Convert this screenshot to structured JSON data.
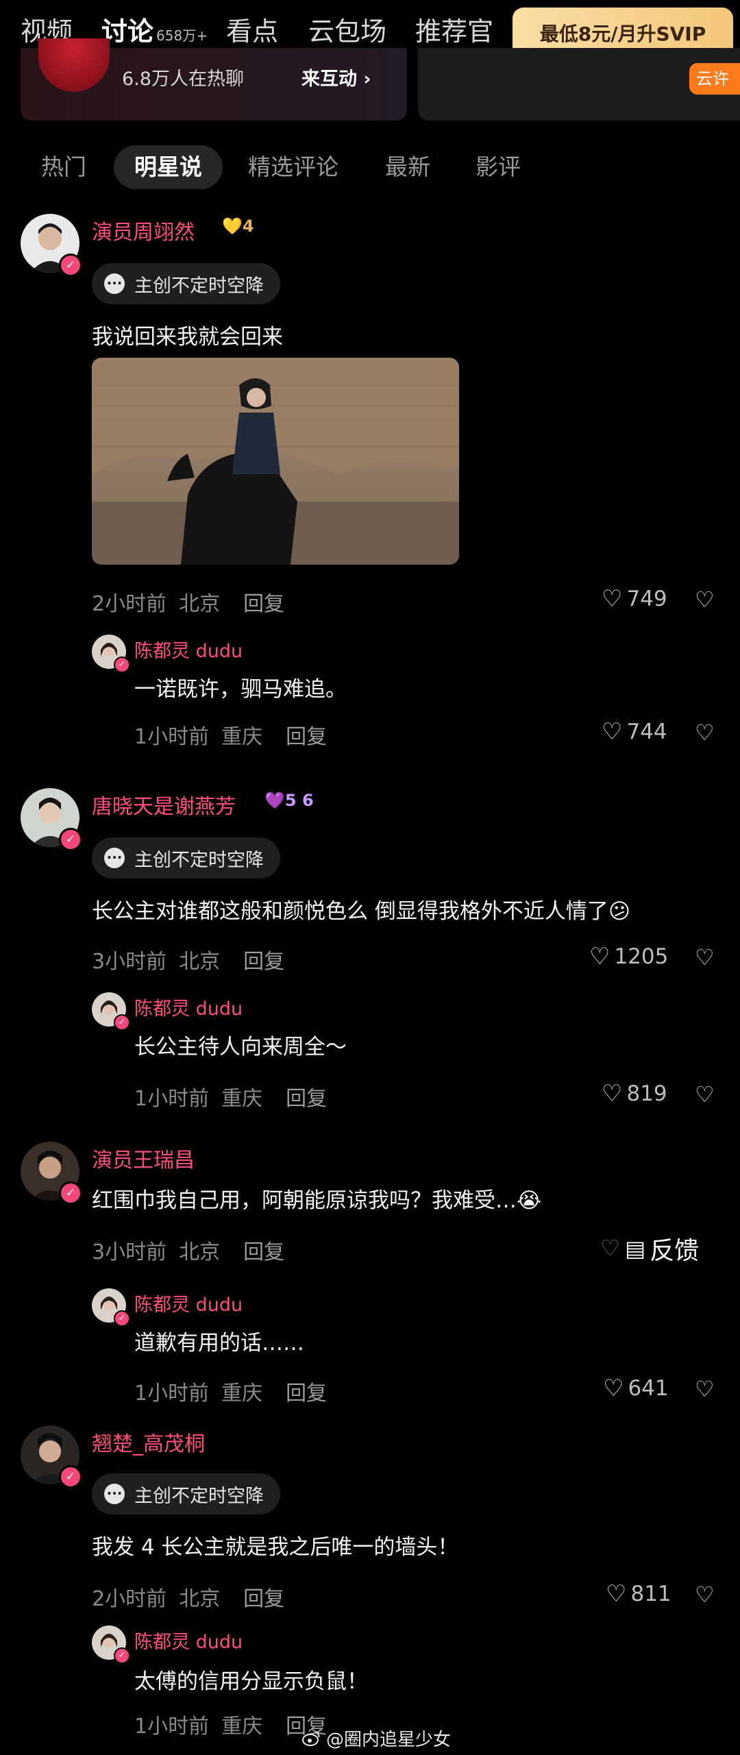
{
  "topnav": {
    "tabs": [
      "视频",
      "讨论",
      "看点",
      "云包场",
      "推荐官"
    ],
    "discuss_count": "658万+",
    "svip_label": "最低8元/月升SVIP"
  },
  "banner": {
    "online_text": "6.8万人在热聊",
    "join_label": "来互动 ›",
    "right_tag": "云许"
  },
  "subtabs": [
    "热门",
    "明星说",
    "精选评论",
    "最新",
    "影评"
  ],
  "comments": [
    {
      "user": "演员周翊然",
      "badge": "4",
      "tag": "主创不定时空降",
      "text": "我说回来我就会回来",
      "time": "2小时前",
      "location": "北京",
      "reply": "回复",
      "likes": "749",
      "sub": {
        "user": "陈都灵 dudu",
        "text": "一诺既许，驷马难追。",
        "time": "1小时前",
        "location": "重庆",
        "reply": "回复",
        "likes": "744"
      }
    },
    {
      "user": "唐晓天是谢燕芳",
      "badge": "5 6",
      "tag": "主创不定时空降",
      "text": "长公主对谁都这般和颜悦色么 倒显得我格外不近人情了😕",
      "time": "3小时前",
      "location": "北京",
      "reply": "回复",
      "likes": "1205",
      "sub": {
        "user": "陈都灵 dudu",
        "text": "长公主待人向来周全～",
        "time": "1小时前",
        "location": "重庆",
        "reply": "回复",
        "likes": "819"
      }
    },
    {
      "user": "演员王瑞昌",
      "text": "红围巾我自己用，阿朝能原谅我吗？我难受…😭",
      "time": "3小时前",
      "location": "北京",
      "reply": "回复",
      "sub": {
        "user": "陈都灵 dudu",
        "text": "道歉有用的话……",
        "time": "1小时前",
        "location": "重庆",
        "reply": "回复",
        "likes": "641"
      }
    },
    {
      "user": "翘楚_高茂桐",
      "tag": "主创不定时空降",
      "text": "我发 4 长公主就是我之后唯一的墙头！",
      "time": "2小时前",
      "location": "北京",
      "reply": "回复",
      "likes": "811",
      "sub": {
        "user": "陈都灵 dudu",
        "text": "太傅的信用分显示负鼠！",
        "time": "1小时前",
        "location": "重庆",
        "reply": "回复"
      }
    }
  ],
  "feedback_label": "反馈",
  "watermark": "@圈内追星少女",
  "icons": {
    "like": "heart-outline-icon",
    "dislike": "broken-heart-icon",
    "tag": "chat-bubble-icon",
    "verified": "verified-badge-icon"
  },
  "colors": {
    "username": "#ff4d7a",
    "svip_gradient_start": "#f9dea3",
    "svip_gradient_end": "#f3c77b",
    "background": "#000000"
  }
}
